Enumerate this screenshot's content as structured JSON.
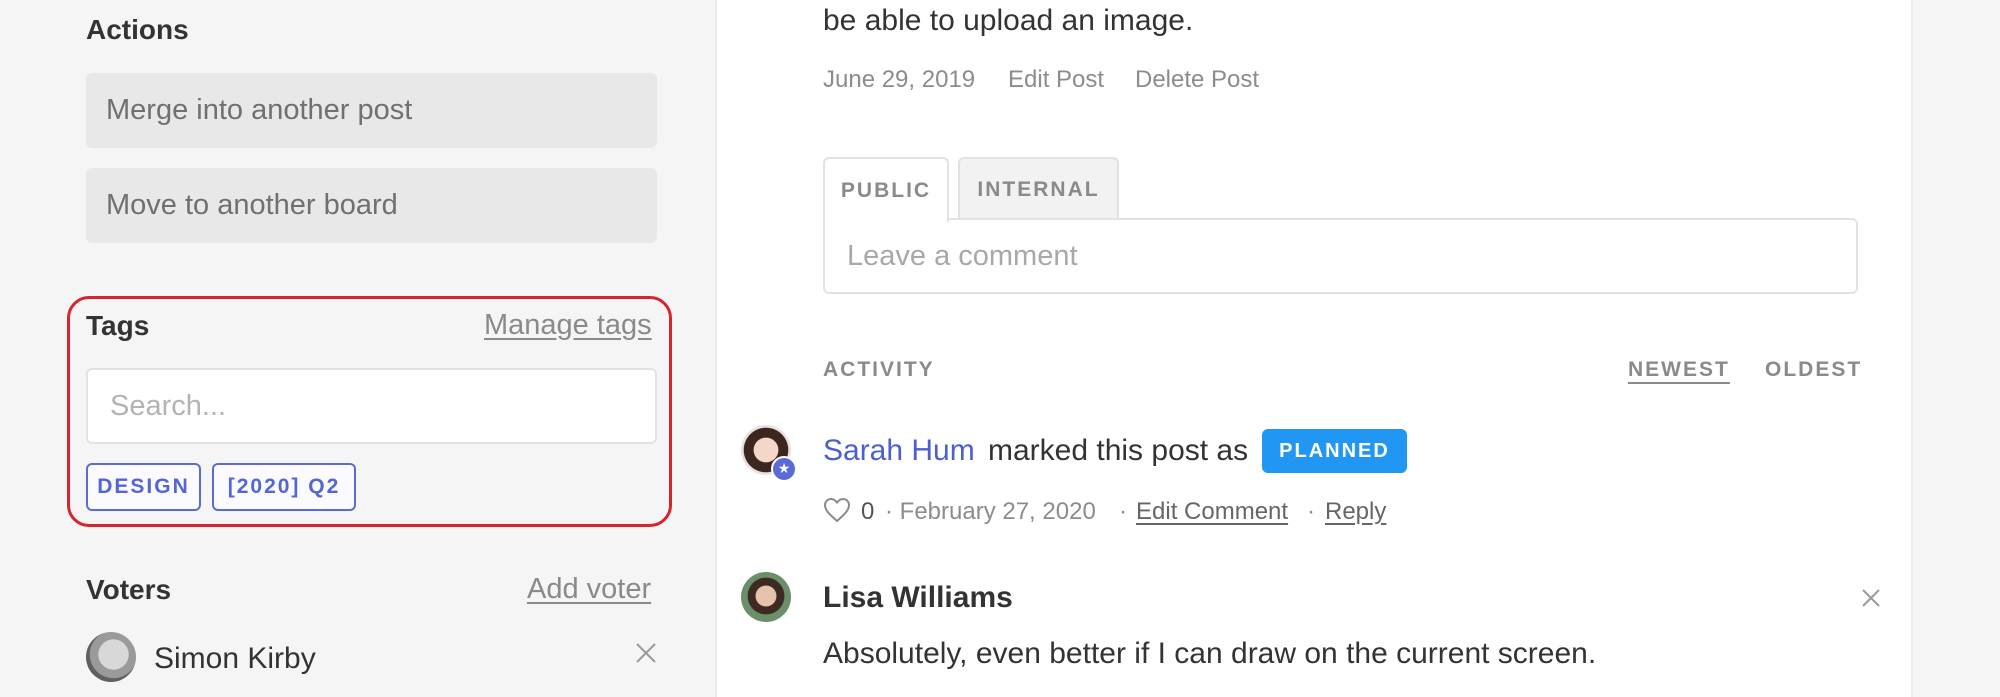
{
  "sidebar": {
    "actions": {
      "heading": "Actions",
      "merge_label": "Merge into another post",
      "move_label": "Move to another board"
    },
    "tags": {
      "heading": "Tags",
      "manage_label": "Manage tags",
      "search_placeholder": "Search...",
      "items": [
        "DESIGN",
        "[2020] Q2"
      ]
    },
    "voters": {
      "heading": "Voters",
      "add_label": "Add voter",
      "items": [
        {
          "name": "Simon Kirby"
        }
      ]
    }
  },
  "post": {
    "text_tail": "be able to upload an image.",
    "date": "June 29, 2019",
    "edit_label": "Edit Post",
    "delete_label": "Delete Post"
  },
  "comment_tabs": {
    "public_label": "PUBLIC",
    "internal_label": "INTERNAL",
    "input_placeholder": "Leave a comment"
  },
  "activity": {
    "label": "ACTIVITY",
    "sort_newest": "NEWEST",
    "sort_oldest": "OLDEST",
    "status_event": {
      "author": "Sarah Hum",
      "action_text": "marked this post as",
      "status": "PLANNED",
      "status_color": "#2196f3",
      "like_count": "0",
      "date": "· February 27, 2020",
      "sep1": "·",
      "edit_label": "Edit Comment",
      "sep2": "·",
      "reply_label": "Reply"
    },
    "comment": {
      "author": "Lisa Williams",
      "body": "Absolutely, even better if I can draw on the current screen."
    }
  },
  "colors": {
    "accent": "#4b5fd0",
    "tag_border": "#5b6bd6",
    "highlight": "#d6252e"
  }
}
